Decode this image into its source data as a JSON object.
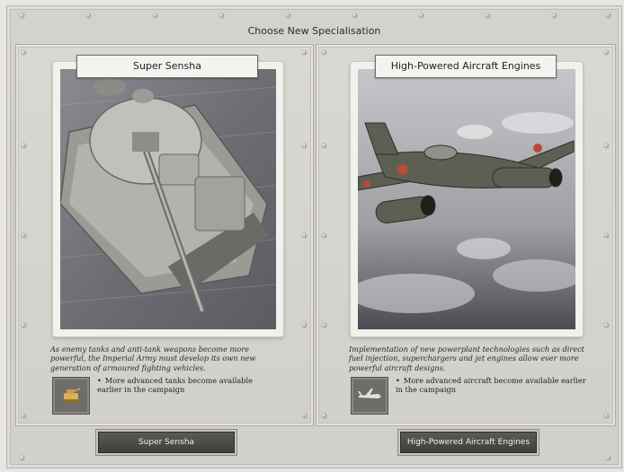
{
  "window": {
    "title": "Choose New Specialisation"
  },
  "options": [
    {
      "name": "Super Sensha",
      "description": "As enemy tanks and anti-tank weapons become more powerful, the Imperial Army must develop its own new generation of armoured fighting vehicles.",
      "bullet": "More advanced tanks become available earlier in the campaign",
      "icon": "tank-icon",
      "button_label": "Super Sensha"
    },
    {
      "name": "High-Powered Aircraft Engines",
      "description": "Implementation of new powerplant technologies such as direct fuel injection, superchargers and jet engines allow ever more powerful aircraft designs.",
      "bullet": "More advanced aircraft become available earlier in the campaign",
      "icon": "aircraft-icon",
      "button_label": "High-Powered Aircraft Engines"
    }
  ],
  "colors": {
    "background": "#e7e6e4",
    "panel": "#d5d3cf",
    "button": "#4a4947",
    "button_text": "#f0efec",
    "roundel": "#b84a3a"
  }
}
